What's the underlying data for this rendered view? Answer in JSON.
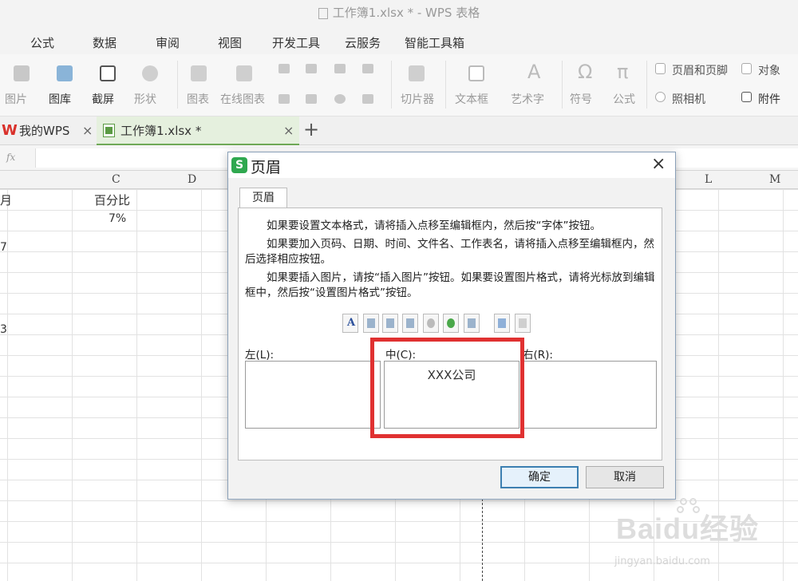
{
  "window": {
    "title": "工作簿1.xlsx * - WPS 表格"
  },
  "menu": [
    "公式",
    "数据",
    "审阅",
    "视图",
    "开发工具",
    "云服务",
    "智能工具箱"
  ],
  "ribbon": {
    "picture": "图片",
    "gallery": "图库",
    "screenshot": "截屏",
    "shape": "形状",
    "chart": "图表",
    "online_chart": "在线图表",
    "slicer": "切片器",
    "textbox": "文本框",
    "wordart": "艺术字",
    "symbol": "符号",
    "formula": "公式",
    "header_footer": "页眉和页脚",
    "object": "对象",
    "camera": "照相机",
    "attachment": "附件",
    "symbol_glyph": "Ω",
    "formula_glyph": "π",
    "wordart_glyph": "A"
  },
  "tabs": {
    "home": "我的WPS",
    "file": "工作簿1.xlsx *",
    "close": "×",
    "plus": "+"
  },
  "formula_bar": {
    "label": "fx"
  },
  "columns": [
    "C",
    "D",
    "L",
    "M"
  ],
  "cells": {
    "c1": "百分比",
    "c2": "7%",
    "a1_partial": "月",
    "a3_partial": "7",
    "a6_partial": "3"
  },
  "dialog": {
    "title": "页眉",
    "logo": "S",
    "close": "×",
    "tab": "页眉",
    "instructions": [
      "如果要设置文本格式，请将插入点移至编辑框内，然后按“字体”按钮。",
      "如果要加入页码、日期、时间、文件名、工作表名，请将插入点移至编辑框内，然后选择相应按钮。",
      "如果要插入图片，请按“插入图片”按钮。如果要设置图片格式，请将光标放到编辑框中，然后按“设置图片格式”按钮。"
    ],
    "toolbar_font_glyph": "A",
    "left_label": "左(L):",
    "center_label": "中(C):",
    "right_label": "右(R):",
    "center_value": "XXX公司",
    "ok": "确定",
    "cancel": "取消"
  },
  "watermark": {
    "main": "Baidu经验",
    "sub": "jingyan.baidu.com"
  },
  "colors": {
    "highlight": "#e03131",
    "accent_green": "#2fa84f",
    "wps_red": "#d9312b"
  }
}
